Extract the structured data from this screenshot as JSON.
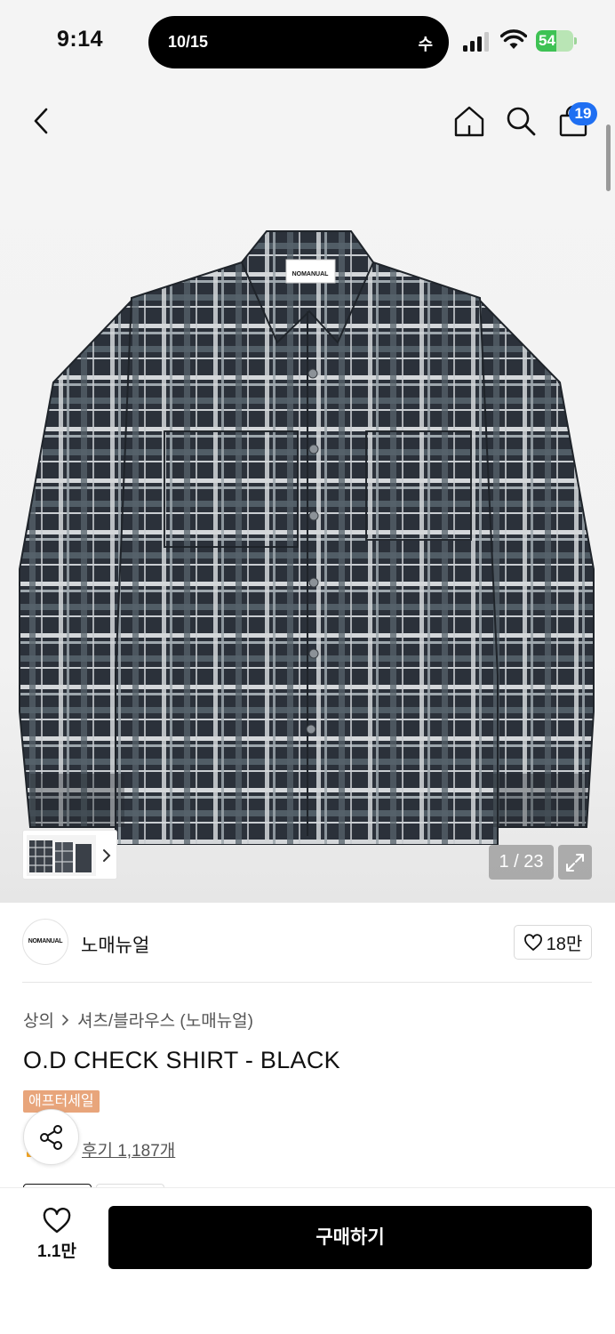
{
  "status_bar": {
    "time": "9:14",
    "island_left": "10/15",
    "island_right": "수",
    "battery": "54",
    "battery_level": 0.54
  },
  "header": {
    "icons": [
      "back-icon",
      "home-icon",
      "search-icon",
      "cart-icon"
    ],
    "cart_count": "19"
  },
  "gallery": {
    "counter": "1 / 23",
    "logo_tag": "NOMANUAL"
  },
  "brand": {
    "logo_text": "NOMANUAL",
    "name": "노매뉴얼",
    "likes": "18만"
  },
  "product": {
    "breadcrumb": [
      "상의",
      "셔츠/블라우스 (노매뉴얼)"
    ],
    "title": "O.D CHECK SHIRT - BLACK",
    "sale_badge": "애프터세일",
    "reviews": "후기 1,187개"
  },
  "bottom_bar": {
    "wish_count": "1.1만",
    "buy_label": "구매하기"
  },
  "colors": {
    "accent_blue": "#1f6ff2",
    "sale_orange": "#e8a57b",
    "buy_button": "#000000",
    "battery_green": "#3ec254"
  }
}
